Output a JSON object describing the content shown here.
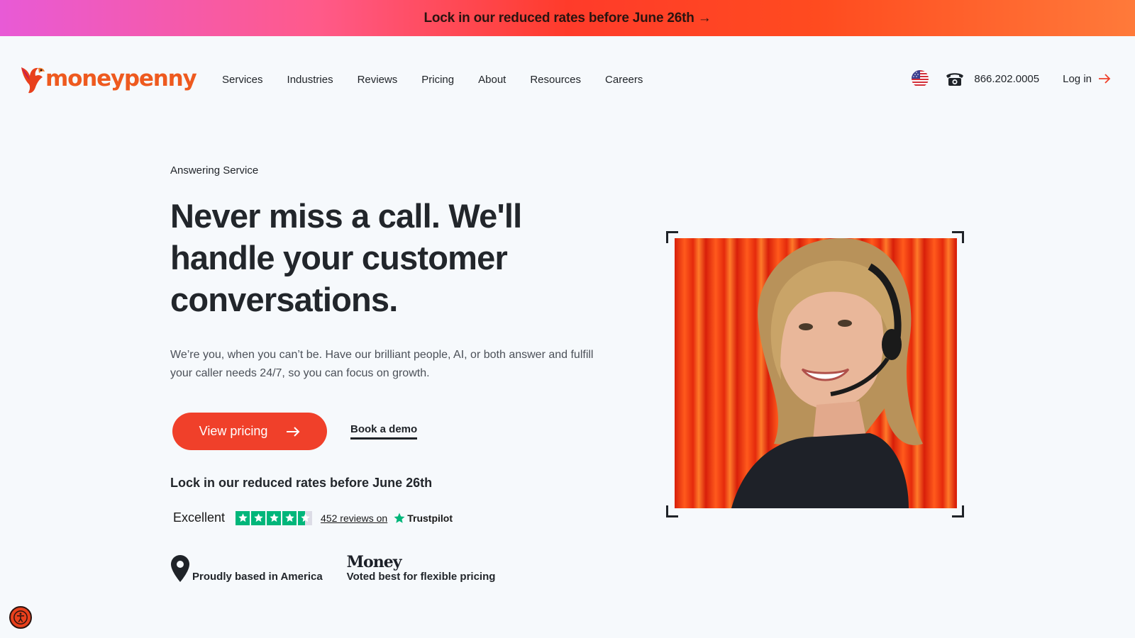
{
  "promo": {
    "text": "Lock in our reduced rates before June 26th →"
  },
  "header": {
    "logo_text": "moneypenny",
    "nav": [
      "Services",
      "Industries",
      "Reviews",
      "Pricing",
      "About",
      "Resources",
      "Careers"
    ],
    "phone": "866.202.0005",
    "login_label": "Log in"
  },
  "hero": {
    "eyebrow": "Answering Service",
    "title": "Never miss a call. We'll handle your customer conversations.",
    "lead": "We’re you, when you can’t be. Have our brilliant people, AI, or both answer and fulfill your caller needs 24/7, so you can focus on growth.",
    "primary_cta": "View pricing",
    "secondary_cta": "Book a demo",
    "offer": "Lock in our reduced rates before June 26th"
  },
  "trustpilot": {
    "rating_word": "Excellent",
    "stars": 4.5,
    "reviews_text": "452 reviews on",
    "brand": "Trustpilot"
  },
  "badges": {
    "america": "Proudly based in America",
    "money_logo": "Money",
    "money_text": "Voted best for flexible pricing"
  },
  "colors": {
    "accent": "#f0402a",
    "brand_orange": "#ee5a1f",
    "trustpilot_green": "#00b67a",
    "background": "#f6f9fc"
  },
  "icons": [
    "us-flag-icon",
    "phone-icon",
    "arrow-right-icon",
    "star-icon",
    "map-pin-icon",
    "accessibility-icon"
  ]
}
